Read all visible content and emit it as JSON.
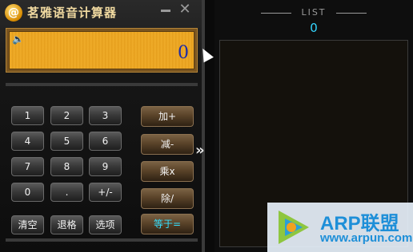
{
  "window": {
    "title": "茗雅语音计算器",
    "app_icon": "@"
  },
  "display": {
    "value": "0",
    "icon": "speaker-icon"
  },
  "keypad": {
    "digits": [
      "1",
      "2",
      "3",
      "4",
      "5",
      "6",
      "7",
      "8",
      "9",
      "0",
      ".",
      "+/-"
    ],
    "clear": "清空",
    "backspace": "退格",
    "options": "选项"
  },
  "operators": {
    "add": "加+",
    "subtract": "减-",
    "multiply": "乘x",
    "divide": "除/",
    "equals": "等于="
  },
  "expand_arrow": "»",
  "list": {
    "title": "LIST",
    "count": "0"
  },
  "watermark": {
    "brand": "ARP联盟",
    "url": "www.arpun.com"
  },
  "colors": {
    "display_bg": "#f0ad2a",
    "display_text": "#1a2aa8",
    "equals_text": "#33e0ff",
    "list_count": "#33d6ff",
    "watermark_text": "#1e8fd8"
  }
}
